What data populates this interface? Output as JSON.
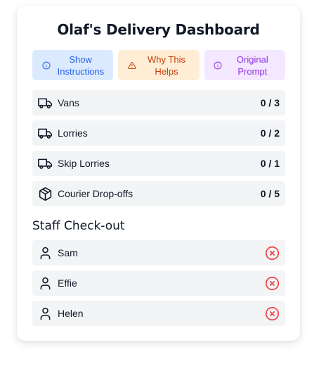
{
  "title": "Olaf's Delivery Dashboard",
  "buttons": [
    {
      "label": "Show Instructions",
      "icon": "info-icon",
      "color": "#2563eb"
    },
    {
      "label": "Why This Helps",
      "icon": "warning-icon",
      "color": "#c2410c"
    },
    {
      "label": "Original Prompt",
      "icon": "info-icon",
      "color": "#9333ea"
    }
  ],
  "deliveries": [
    {
      "name": "Vans",
      "count": "0 / 3",
      "icon": "truck-icon"
    },
    {
      "name": "Lorries",
      "count": "0 / 2",
      "icon": "truck-icon"
    },
    {
      "name": "Skip Lorries",
      "count": "0 / 1",
      "icon": "truck-icon"
    },
    {
      "name": "Courier Drop-offs",
      "count": "0 / 5",
      "icon": "package-icon"
    }
  ],
  "staff_section": {
    "title": "Staff Check-out",
    "members": [
      {
        "name": "Sam",
        "status": "not checked out",
        "icon": "user-icon"
      },
      {
        "name": "Effie",
        "status": "not checked out",
        "icon": "user-icon"
      },
      {
        "name": "Helen",
        "status": "not checked out",
        "icon": "user-icon"
      }
    ]
  },
  "colors": {
    "row_bg": "#f3f4f6",
    "x_red": "#ef4444"
  }
}
